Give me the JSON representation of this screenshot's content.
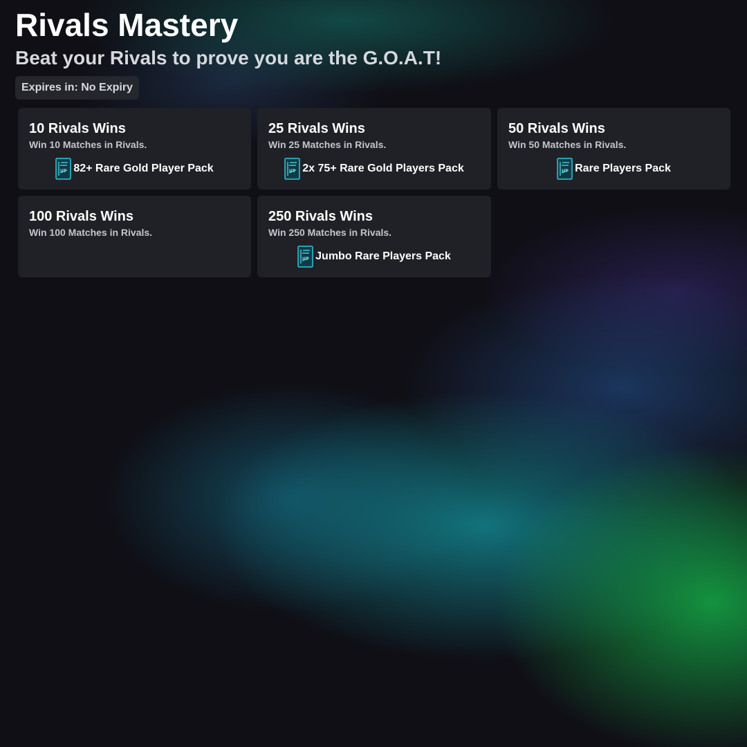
{
  "header": {
    "title": "Rivals Mastery",
    "subtitle": "Beat your Rivals to prove you are the G.O.A.T!",
    "expiry": "Expires in: No Expiry"
  },
  "objectives": [
    {
      "title": "10 Rivals Wins",
      "description": "Win 10 Matches in Rivals.",
      "reward": "82+ Rare Gold Player Pack",
      "reward_icon": "pack-icon"
    },
    {
      "title": "25 Rivals Wins",
      "description": "Win 25 Matches in Rivals.",
      "reward": "2x 75+ Rare Gold Players Pack",
      "reward_icon": "pack-icon"
    },
    {
      "title": "50 Rivals Wins",
      "description": "Win 50 Matches in Rivals.",
      "reward": "Rare Players Pack",
      "reward_icon": "pack-icon"
    },
    {
      "title": "100 Rivals Wins",
      "description": "Win 100 Matches in Rivals."
    },
    {
      "title": "250 Rivals Wins",
      "description": "Win 250 Matches in Rivals.",
      "reward": "Jumbo Rare Players Pack",
      "reward_icon": "pack-icon"
    }
  ],
  "colors": {
    "card_background": "#1f2126",
    "pack_accent": "#2ec6d8"
  }
}
